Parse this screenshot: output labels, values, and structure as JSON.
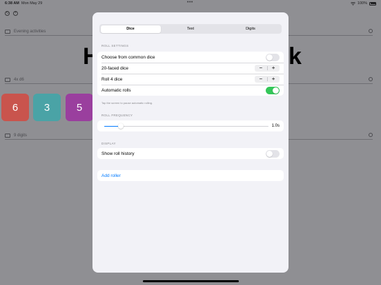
{
  "status_bar": {
    "time": "6:38 AM",
    "date": "Mon May 29",
    "dots": "•••",
    "battery_percent": "100%",
    "battery_level": 1.0
  },
  "background": {
    "rows": [
      {
        "label": "Evening activities"
      },
      {
        "label": "4x d6"
      },
      {
        "label": "9 digits"
      }
    ],
    "big_text_left": "H",
    "big_text_right": "k",
    "dice": [
      {
        "value": "6",
        "color": "#c9544d"
      },
      {
        "value": "3",
        "color": "#4aa3a6"
      },
      {
        "value": "5",
        "color": "#9a3f9e"
      }
    ]
  },
  "modal": {
    "tabs": [
      {
        "label": "Dice",
        "active": true
      },
      {
        "label": "Text",
        "active": false
      },
      {
        "label": "Digits",
        "active": false
      }
    ],
    "roll_settings": {
      "header": "ROLL SETTINGS",
      "choose_common_dice": {
        "label": "Choose from common dice",
        "on": false
      },
      "faces": {
        "label": "20-faced dice",
        "minus": "−",
        "plus": "+"
      },
      "count": {
        "label": "Roll 4 dice",
        "minus": "−",
        "plus": "+"
      },
      "automatic_rolls": {
        "label": "Automatic rolls",
        "on": true
      },
      "footnote": "Tap the screen to pause automatic rolling."
    },
    "roll_frequency": {
      "header": "ROLL FREQUENCY",
      "value_label": "1.0s",
      "fraction": 0.1
    },
    "display": {
      "header": "DISPLAY",
      "show_roll_history": {
        "label": "Show roll history",
        "on": false
      }
    },
    "add_roller": "Add roller"
  },
  "colors": {
    "accent": "#007aff",
    "toggle_on": "#34c759",
    "dim_background": "#8f8f93"
  }
}
